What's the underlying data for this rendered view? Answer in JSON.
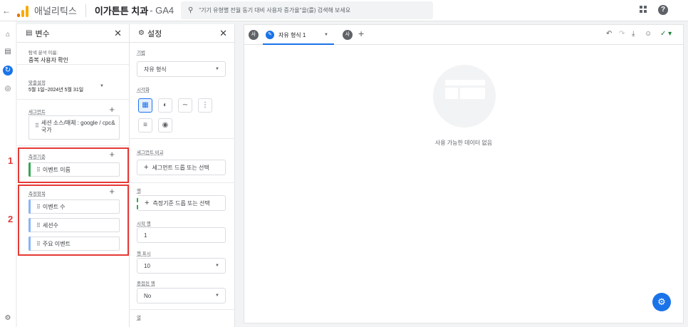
{
  "topbar": {
    "back": "←",
    "app_name": "애널리틱스",
    "property_name": "이가튼튼 치과",
    "property_suffix": " - GA4",
    "search_placeholder": "\"기기 유형별 전월 동기 대비 사용자 증가율\"을(를) 검색해 보세요"
  },
  "rail": {
    "icons": [
      "home-icon",
      "reports-icon",
      "explore-icon",
      "advertising-icon",
      "settings-icon"
    ]
  },
  "variables": {
    "title": "변수",
    "exploration_name_label": "탐색 분석 이름:",
    "exploration_name": "중복 사용자 확인",
    "date_label": "맞춤설정",
    "date_value": "5월 1일~2024년 5월 31일",
    "segments_label": "세그먼트",
    "segment_chip": "세션 소스/매체 : google / cpc&국가",
    "dimensions_label": "측정기준",
    "dimension_chip": "이벤트 이름",
    "metrics_label": "측정항목",
    "metric_chips": [
      "이벤트 수",
      "세션수",
      "주요 이벤트"
    ],
    "annotation_1": "1",
    "annotation_2": "2"
  },
  "settings": {
    "title": "설정",
    "technique_label": "기법",
    "technique_value": "자유 형식",
    "viz_label": "시각화",
    "segment_compare_label": "세그먼트 비교",
    "segment_drop": "세그먼트 드롭 또는 선택",
    "rows_label": "행",
    "rows_drop": "측정기준 드롭 또는 선택",
    "start_row_label": "시작 행",
    "start_row_value": "1",
    "show_rows_label": "행 표시",
    "show_rows_value": "10",
    "nested_rows_label": "중첩된 행",
    "nested_rows_value": "No",
    "columns_label": "열"
  },
  "canvas": {
    "tab_name": "자유 형식 1",
    "tab_segment_badge": "사",
    "tab_add": "+",
    "empty_text": "사용 가능한 데이터 없음"
  },
  "colors": {
    "accent": "#1a73e8",
    "annotation": "#e53935",
    "dimension_bar": "#34a853",
    "metric_bar": "#8ab4f8"
  }
}
